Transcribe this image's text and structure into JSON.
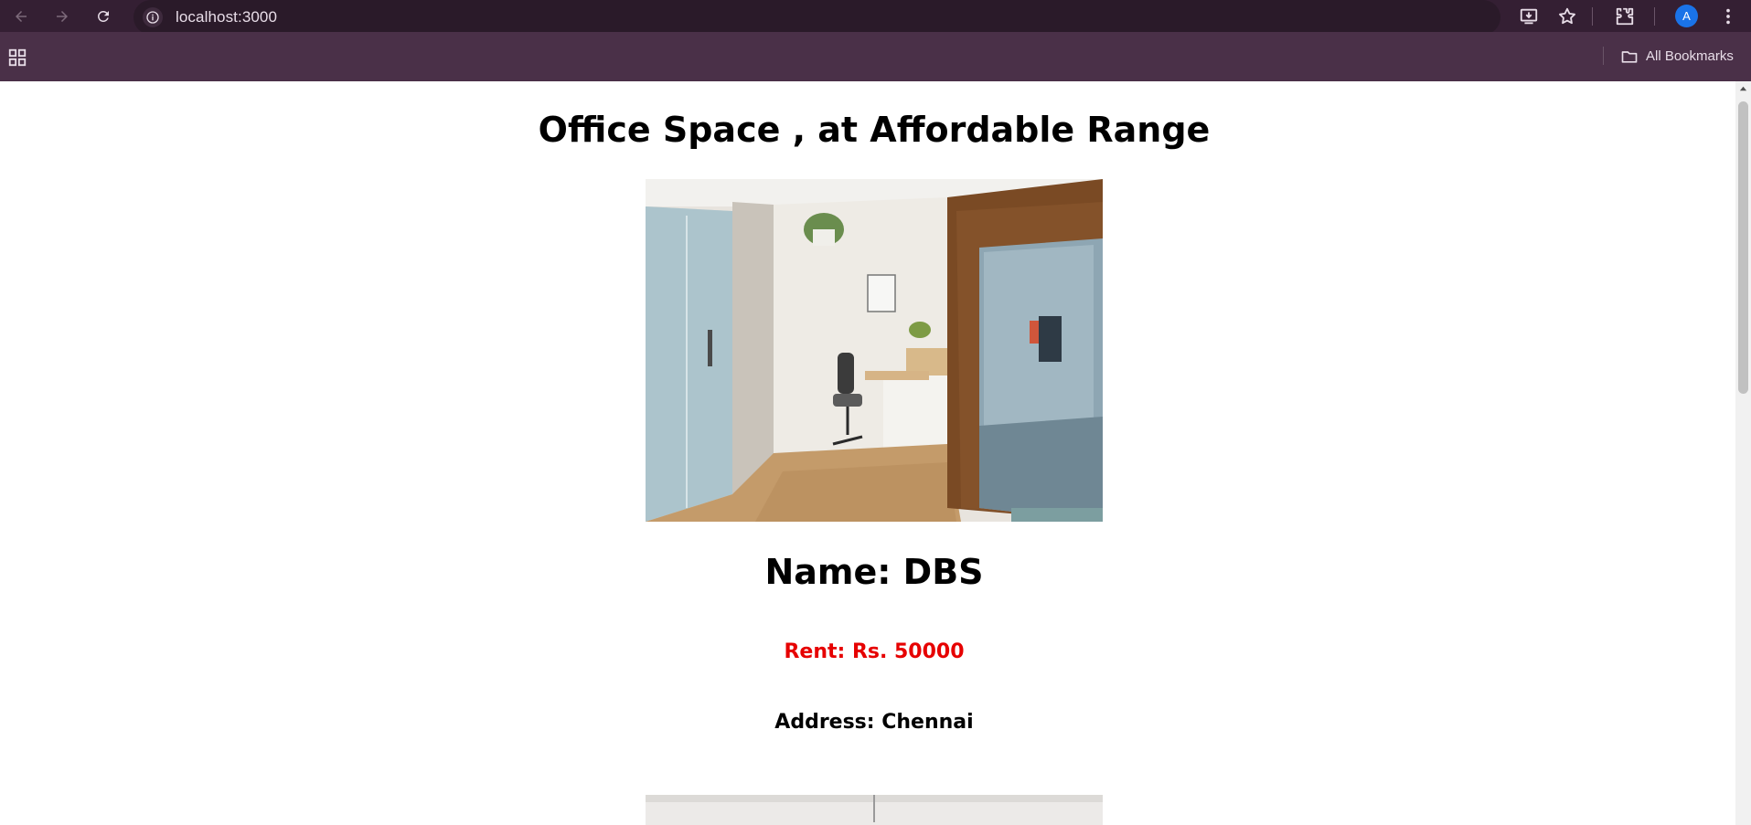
{
  "browser": {
    "url": "localhost:3000",
    "bookmarks_label": "All Bookmarks",
    "profile_initial": "A"
  },
  "page": {
    "title": "Office Space , at Affordable Range",
    "listing": {
      "name": "Name: DBS",
      "rent": "Rent: Rs. 50000",
      "address": "Address: Chennai"
    }
  },
  "colors": {
    "chrome_top": "#341f33",
    "chrome_bookmarks": "#4a3048",
    "rent": "#e60000",
    "avatar": "#1a73e8"
  },
  "icons": [
    "back-arrow-icon",
    "forward-arrow-icon",
    "reload-icon",
    "info-icon",
    "install-app-icon",
    "star-icon",
    "extensions-icon",
    "more-vert-icon",
    "apps-grid-icon",
    "folder-icon"
  ]
}
